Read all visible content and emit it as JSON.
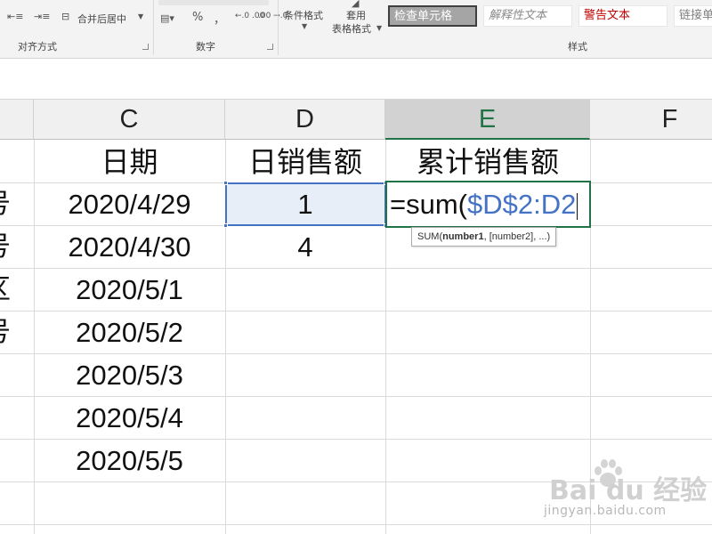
{
  "ribbon": {
    "alignment": {
      "group_label": "对齐方式",
      "merge_center_label": "合并后居中"
    },
    "number": {
      "group_label": "数字",
      "percent_symbol": "%",
      "comma_symbol": "，",
      "inc_decimal_label": "←.0 .00",
      "dec_decimal_label": ".00 →.0"
    },
    "styles": {
      "group_label": "样式",
      "conditional_format_label": "条件格式",
      "table_format_line1": "套用",
      "table_format_line2": "表格格式",
      "cell_styles": [
        "检查单元格",
        "解释性文本",
        "警告文本",
        "链接单"
      ]
    }
  },
  "sheet": {
    "column_headers": [
      "C",
      "D",
      "E",
      "F"
    ],
    "active_column": "E",
    "row_header_cut_glyphs": [
      "",
      "号",
      "号",
      "区",
      "号"
    ],
    "header_row": {
      "C": "日期",
      "D": "日销售额",
      "E": "累计销售额"
    },
    "dates": [
      "2020/4/29",
      "2020/4/30",
      "2020/5/1",
      "2020/5/2",
      "2020/5/3",
      "2020/5/4",
      "2020/5/5"
    ],
    "daily_sales": [
      "1",
      "4"
    ],
    "editing_cell": {
      "formula_prefix": "=sum(",
      "formula_ref": "$D$2:D2"
    },
    "tooltip": {
      "func": "SUM(",
      "arg1": "number1",
      "rest": ", [number2], ...)"
    }
  },
  "watermark": {
    "brand": "Bai du 经验",
    "url": "jingyan.baidu.com"
  }
}
